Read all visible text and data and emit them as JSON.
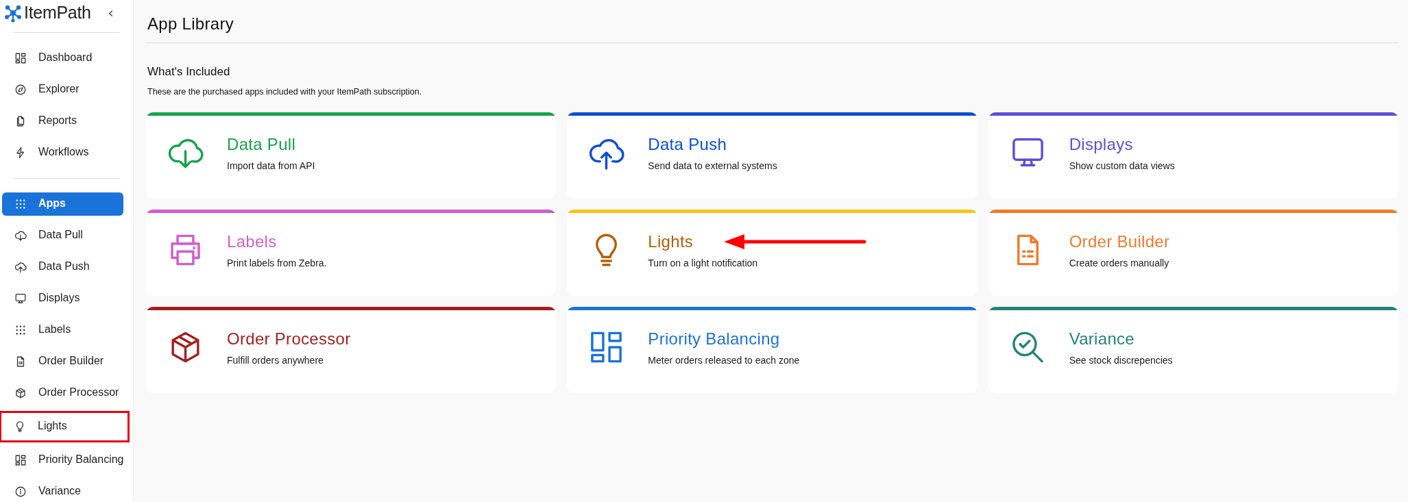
{
  "sidebar": {
    "logo": "ItemPath",
    "collapse": "‹",
    "groups": [
      {
        "items": [
          {
            "label": "Dashboard",
            "selected": false,
            "highlighted": false
          },
          {
            "label": "Explorer",
            "selected": false,
            "highlighted": false
          },
          {
            "label": "Reports",
            "selected": false,
            "highlighted": false
          },
          {
            "label": "Workflows",
            "selected": false,
            "highlighted": false
          }
        ]
      },
      {
        "items": [
          {
            "label": "Apps",
            "selected": true,
            "highlighted": false
          },
          {
            "label": "Data Pull",
            "selected": false,
            "highlighted": false
          },
          {
            "label": "Data Push",
            "selected": false,
            "highlighted": false
          },
          {
            "label": "Displays",
            "selected": false,
            "highlighted": false
          },
          {
            "label": "Labels",
            "selected": false,
            "highlighted": false
          },
          {
            "label": "Order Builder",
            "selected": false,
            "highlighted": false
          },
          {
            "label": "Order Processor",
            "selected": false,
            "highlighted": false
          },
          {
            "label": "Lights",
            "selected": false,
            "highlighted": true
          },
          {
            "label": "Priority Balancing",
            "selected": false,
            "highlighted": false
          },
          {
            "label": "Variance",
            "selected": false,
            "highlighted": false
          }
        ]
      }
    ]
  },
  "main": {
    "title": "App Library",
    "section": "What's Included",
    "description": "These are the purchased apps included with your ItemPath subscription.",
    "apps": [
      {
        "name": "Data Pull",
        "description": "Import data from API",
        "color": "#16a34a",
        "bar": {
          "color": "#16a34a"
        },
        "arrow": false
      },
      {
        "name": "Data Push",
        "description": "Send data to external systems",
        "color": "#0b4fd0",
        "bar": {
          "color": "#0b4fd0"
        },
        "arrow": false
      },
      {
        "name": "Displays",
        "description": "Show custom data views",
        "color": "#5b50d6",
        "bar": {
          "color": "#5b50d6"
        },
        "arrow": false
      },
      {
        "name": "Labels",
        "description": "Print labels from Zebra.",
        "color": "#d35cce",
        "bar": {
          "color": "#d35cce"
        },
        "arrow": false
      },
      {
        "name": "Lights",
        "description": "Turn on a light notification",
        "color": "#b45f06",
        "bar": {
          "color": "#f5c518"
        },
        "arrow": true
      },
      {
        "name": "Order Builder",
        "description": "Create orders manually",
        "color": "#f07a2a",
        "bar": {
          "color": "#f07a2a"
        },
        "arrow": false
      },
      {
        "name": "Order Processor",
        "description": "Fulfill orders anywhere",
        "color": "#a3201f",
        "bar": {
          "color": "#a3201f"
        },
        "arrow": false
      },
      {
        "name": "Priority Balancing",
        "description": "Meter orders released to each zone",
        "color": "#1a73d9",
        "bar": {
          "color": "#1a73d9"
        },
        "arrow": false
      },
      {
        "name": "Variance",
        "description": "See stock discrepencies",
        "color": "#23837a",
        "bar": {
          "color": "#23837a"
        },
        "arrow": false
      }
    ]
  }
}
